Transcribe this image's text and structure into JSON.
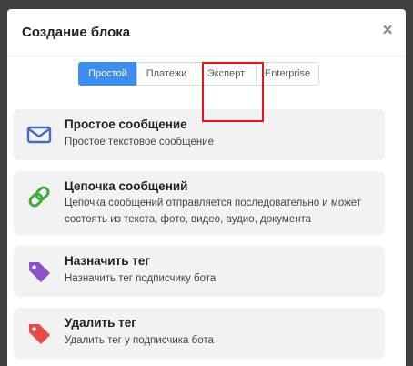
{
  "modal": {
    "title": "Создание блока",
    "close_symbol": "×"
  },
  "tabs": [
    {
      "label": "Простой",
      "active": true
    },
    {
      "label": "Платежи",
      "active": false
    },
    {
      "label": "Эксперт",
      "active": false
    },
    {
      "label": "Enterprise",
      "active": false
    }
  ],
  "blocks": [
    {
      "icon": "envelope-icon",
      "title": "Простое сообщение",
      "description": "Простое текстовое сообщение",
      "color": "#3d6fc4"
    },
    {
      "icon": "chain-link-icon",
      "title": "Цепочка сообщений",
      "description": "Цепочка сообщений отправляется последовательно и может состоять из текста, фото, видео, аудио, документа",
      "color": "#3dab3d"
    },
    {
      "icon": "tag-icon",
      "title": "Назначить тег",
      "description": "Назначить тег подписчику бота",
      "color": "#8b52c9"
    },
    {
      "icon": "tag-icon",
      "title": "Удалить тег",
      "description": "Удалить тег у подписчика бота",
      "color": "#e84a4a"
    }
  ],
  "highlight_color": "#e8141b"
}
